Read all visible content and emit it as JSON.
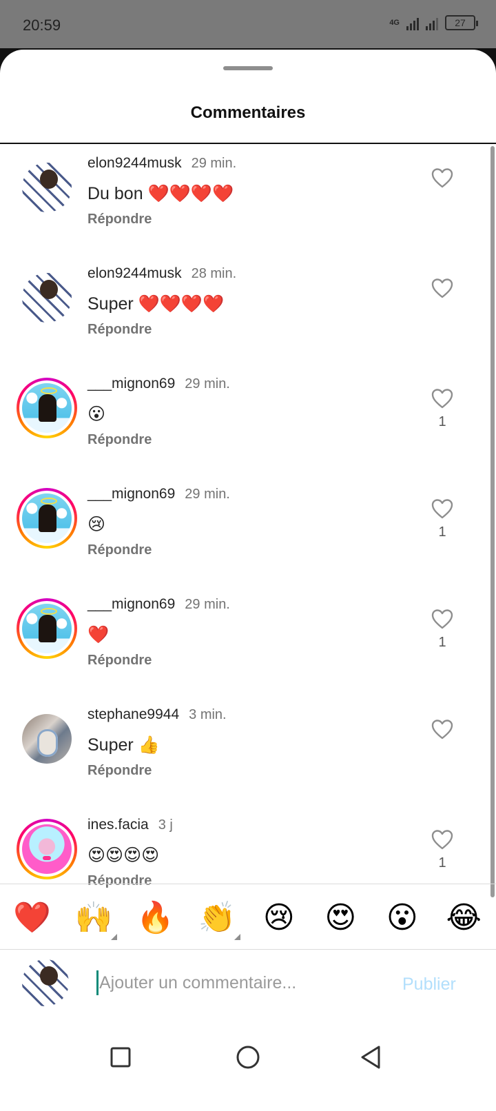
{
  "status_bar": {
    "time": "20:59",
    "network": "4G",
    "battery": "27"
  },
  "sheet": {
    "title": "Commentaires"
  },
  "comments": [
    {
      "username": "elon9244musk",
      "time": "29 min.",
      "body": "Du bon ❤️❤️❤️❤️",
      "reply": "Répondre",
      "likes": "",
      "avatar": "elon"
    },
    {
      "username": "elon9244musk",
      "time": "28 min.",
      "body": "Super ❤️❤️❤️❤️",
      "reply": "Répondre",
      "likes": "",
      "avatar": "elon"
    },
    {
      "username": "___mignon69",
      "time": "29 min.",
      "body": "😮",
      "reply": "Répondre",
      "likes": "1",
      "avatar": "mignon"
    },
    {
      "username": "___mignon69",
      "time": "29 min.",
      "body": "😢",
      "reply": "Répondre",
      "likes": "1",
      "avatar": "mignon"
    },
    {
      "username": "___mignon69",
      "time": "29 min.",
      "body": "❤️",
      "reply": "Répondre",
      "likes": "1",
      "avatar": "mignon"
    },
    {
      "username": "stephane9944",
      "time": "3 min.",
      "body": "Super 👍",
      "reply": "Répondre",
      "likes": "",
      "avatar": "steph"
    },
    {
      "username": "ines.facia",
      "time": "3 j",
      "body": "😍😍😍😍",
      "reply": "Répondre",
      "likes": "1",
      "avatar": "ines"
    }
  ],
  "emoji_bar": [
    "❤️",
    "🙌",
    "🔥",
    "👏",
    "😢",
    "😍",
    "😮",
    "😂"
  ],
  "input": {
    "placeholder": "Ajouter un commentaire...",
    "publish_label": "Publier"
  },
  "colors": {
    "accent_publish": "#b2dffc",
    "story_ring": "#ff0069"
  }
}
